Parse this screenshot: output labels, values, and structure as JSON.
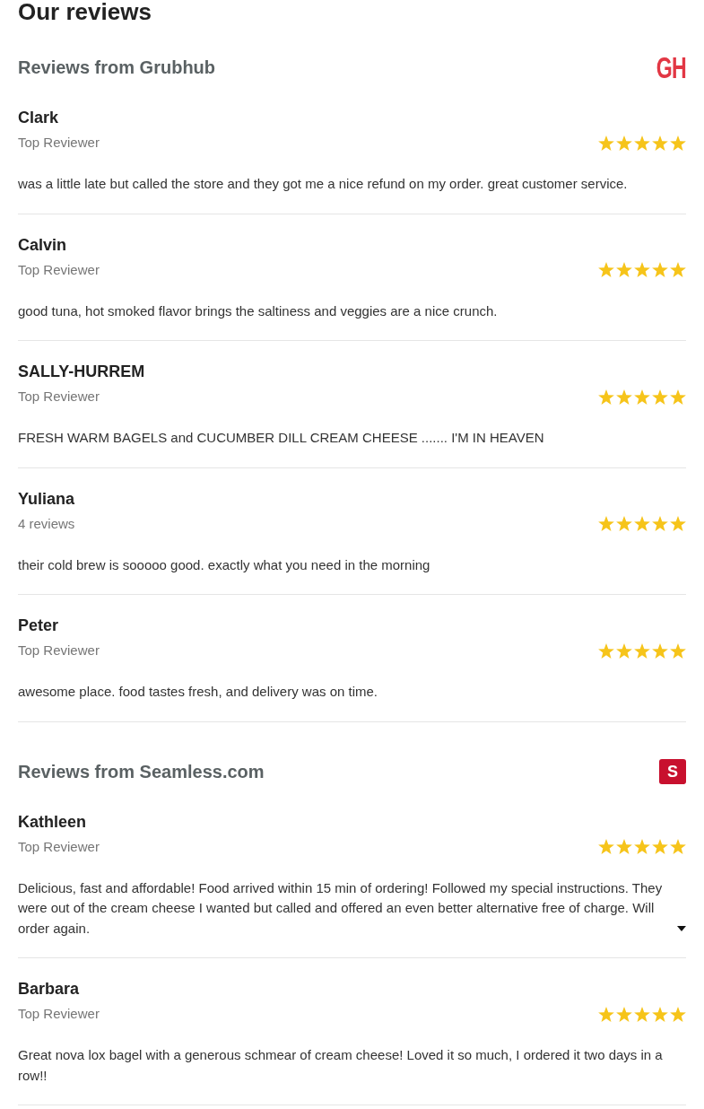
{
  "title": "Our reviews",
  "sections": [
    {
      "heading": "Reviews from Grubhub",
      "logo": {
        "kind": "lettermark",
        "text": "GH"
      },
      "reviews": [
        {
          "name": "Clark",
          "subtitle": "Top Reviewer",
          "stars": 5,
          "text": "was a little late but called the store and they got me a nice refund on my order. great customer service.",
          "expandable": false
        },
        {
          "name": "Calvin",
          "subtitle": "Top Reviewer",
          "stars": 5,
          "text": "good tuna, hot smoked flavor brings the saltiness and veggies are a nice crunch.",
          "expandable": false
        },
        {
          "name": "SALLY-HURREM",
          "subtitle": "Top Reviewer",
          "stars": 5,
          "text": "FRESH WARM BAGELS and CUCUMBER DILL CREAM CHEESE ....... I'M IN HEAVEN",
          "expandable": false
        },
        {
          "name": "Yuliana",
          "subtitle": "4 reviews",
          "stars": 5,
          "text": "their cold brew is sooooo good. exactly what you need in the morning",
          "expandable": false
        },
        {
          "name": "Peter",
          "subtitle": "Top Reviewer",
          "stars": 5,
          "text": "awesome place. food tastes fresh, and delivery was on time.",
          "expandable": false
        }
      ]
    },
    {
      "heading": "Reviews from Seamless.com",
      "logo": {
        "kind": "badge",
        "text": "S"
      },
      "reviews": [
        {
          "name": "Kathleen",
          "subtitle": "Top Reviewer",
          "stars": 5,
          "text": "Delicious, fast and affordable! Food arrived within 15 min of ordering! Followed my special instructions. They were out of the cream cheese I wanted but called and offered an even better alternative free of charge. Will order again.",
          "expandable": true
        },
        {
          "name": "Barbara",
          "subtitle": "Top Reviewer",
          "stars": 5,
          "text": "Great nova lox bagel with a generous schmear of cream cheese! Loved it so much, I ordered it two days in a row!!",
          "expandable": false
        }
      ]
    }
  ]
}
